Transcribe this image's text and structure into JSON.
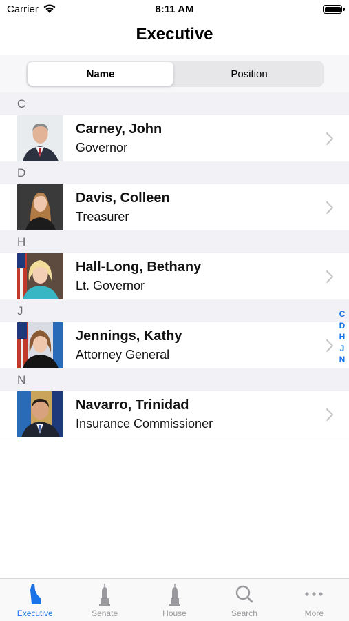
{
  "status_bar": {
    "carrier": "Carrier",
    "time": "8:11 AM"
  },
  "nav": {
    "title": "Executive"
  },
  "segmented": {
    "options": [
      "Name",
      "Position"
    ],
    "selected": "Name"
  },
  "sections": [
    {
      "letter": "C",
      "people": [
        {
          "name": "Carney, John",
          "title": "Governor"
        }
      ]
    },
    {
      "letter": "D",
      "people": [
        {
          "name": "Davis, Colleen",
          "title": "Treasurer"
        }
      ]
    },
    {
      "letter": "H",
      "people": [
        {
          "name": "Hall-Long, Bethany",
          "title": "Lt. Governor"
        }
      ]
    },
    {
      "letter": "J",
      "people": [
        {
          "name": "Jennings, Kathy",
          "title": "Attorney General"
        }
      ]
    },
    {
      "letter": "N",
      "people": [
        {
          "name": "Navarro, Trinidad",
          "title": "Insurance Commissioner"
        }
      ]
    }
  ],
  "index": [
    "C",
    "D",
    "H",
    "J",
    "N"
  ],
  "tabs": [
    {
      "label": "Executive",
      "icon": "delaware-state-icon",
      "active": true
    },
    {
      "label": "Senate",
      "icon": "capitol-icon",
      "active": false
    },
    {
      "label": "House",
      "icon": "capitol-icon",
      "active": false
    },
    {
      "label": "Search",
      "icon": "search-icon",
      "active": false
    },
    {
      "label": "More",
      "icon": "more-icon",
      "active": false
    }
  ],
  "colors": {
    "accent": "#1a73e8",
    "section_bg": "#f2f2f6",
    "inactive_tab": "#9a9a9e"
  }
}
